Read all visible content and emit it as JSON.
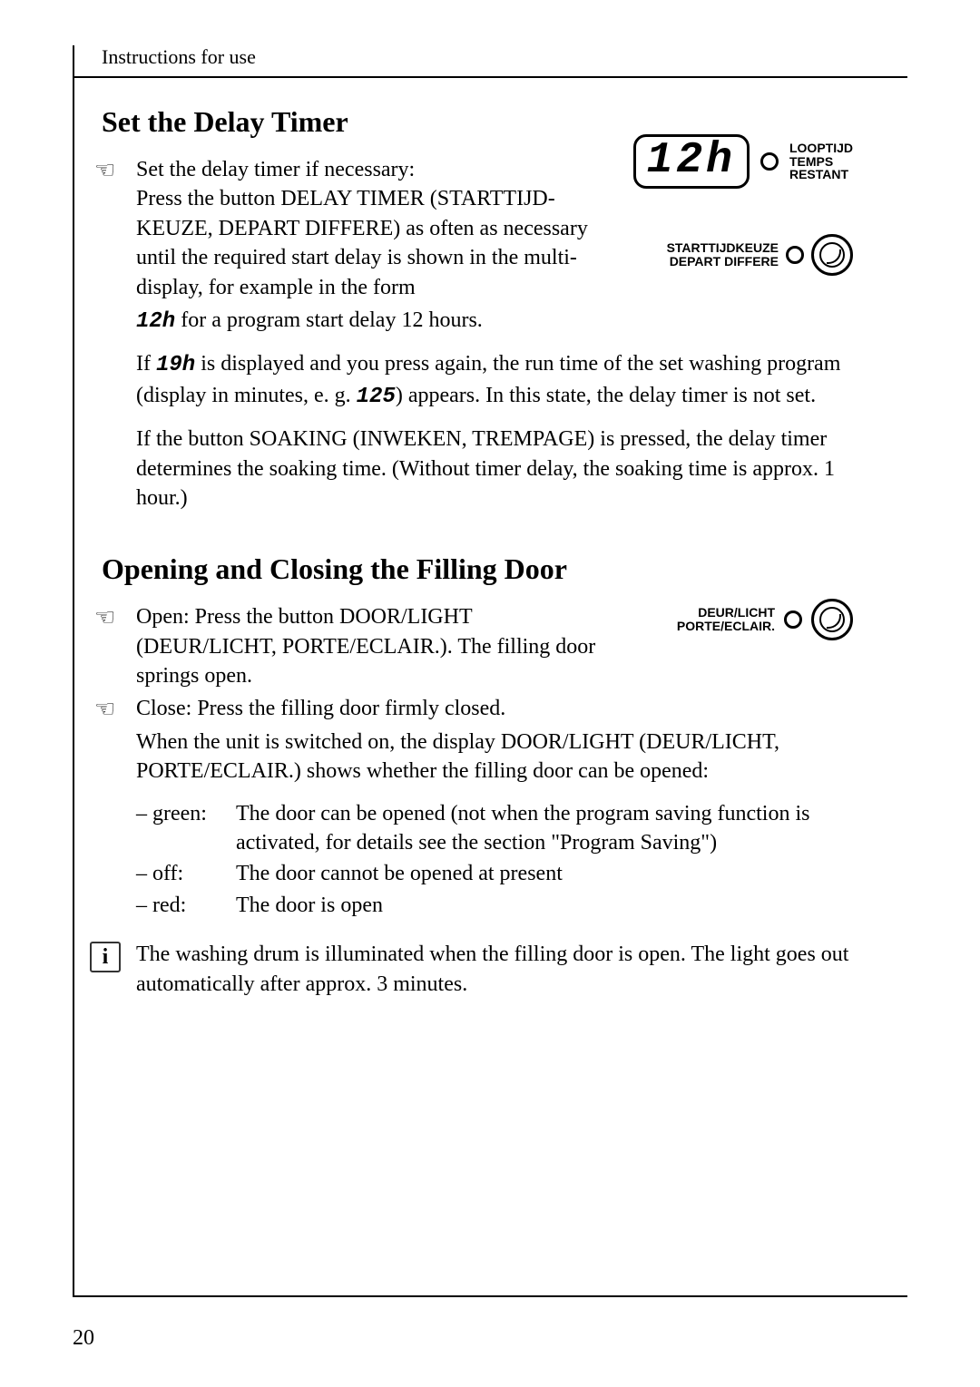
{
  "header": "Instructions for use",
  "page_number": "20",
  "section1": {
    "title": "Set the Delay Timer",
    "para1_line1": "Set the delay timer if necessary:",
    "para1_rest": "Press the button DELAY TIMER (STARTTIJD-KEUZE, DEPART DIFFERE) as often as necessary until the required start delay is shown in the multi-display, for example in the form ",
    "seg12h_inline": "12h",
    "para1_tail": " for a program start delay 12 hours.",
    "para2_pre": "If ",
    "seg19h": "19h",
    "para2_mid": " is displayed and you press again, the run time of the set washing program (display in minutes, e. g. ",
    "seg125": "125",
    "para2_tail": ") appears. In this state, the delay timer is not set.",
    "para3": "If the button SOAKING (INWEKEN, TREMPAGE) is pressed, the delay timer determines the soaking time. (Without timer delay, the soaking time is approx. 1 hour.)"
  },
  "diagram1": {
    "lcd": "12h",
    "label1a": "LOOPTIJD",
    "label1b": "TEMPS",
    "label1c": "RESTANT",
    "label2a": "STARTTIJDKEUZE",
    "label2b": "DEPART DIFFERE"
  },
  "section2": {
    "title": "Opening and Closing the Filling Door",
    "open_text": "Open: Press the button DOOR/LIGHT (DEUR/LICHT, PORTE/ECLAIR.). The filling door springs open.",
    "close_text": "Close: Press the filling door firmly closed.",
    "body1": "When the unit is switched on, the display DOOR/LIGHT (DEUR/LICHT, PORTE/ECLAIR.) shows whether the filling door can be opened:",
    "status": [
      {
        "label": "– green:",
        "text": "The door can be opened (not when the program saving function is activated, for details see the section \"Program Saving\")"
      },
      {
        "label": "– off:",
        "text": "The door cannot be opened at present"
      },
      {
        "label": "– red:",
        "text": "The door is open"
      }
    ],
    "info_text": "The washing drum is illuminated when the filling door is open. The light goes out automatically after approx. 3 minutes."
  },
  "diagram2": {
    "label1": "DEUR/LICHT",
    "label2": "PORTE/ECLAIR."
  }
}
